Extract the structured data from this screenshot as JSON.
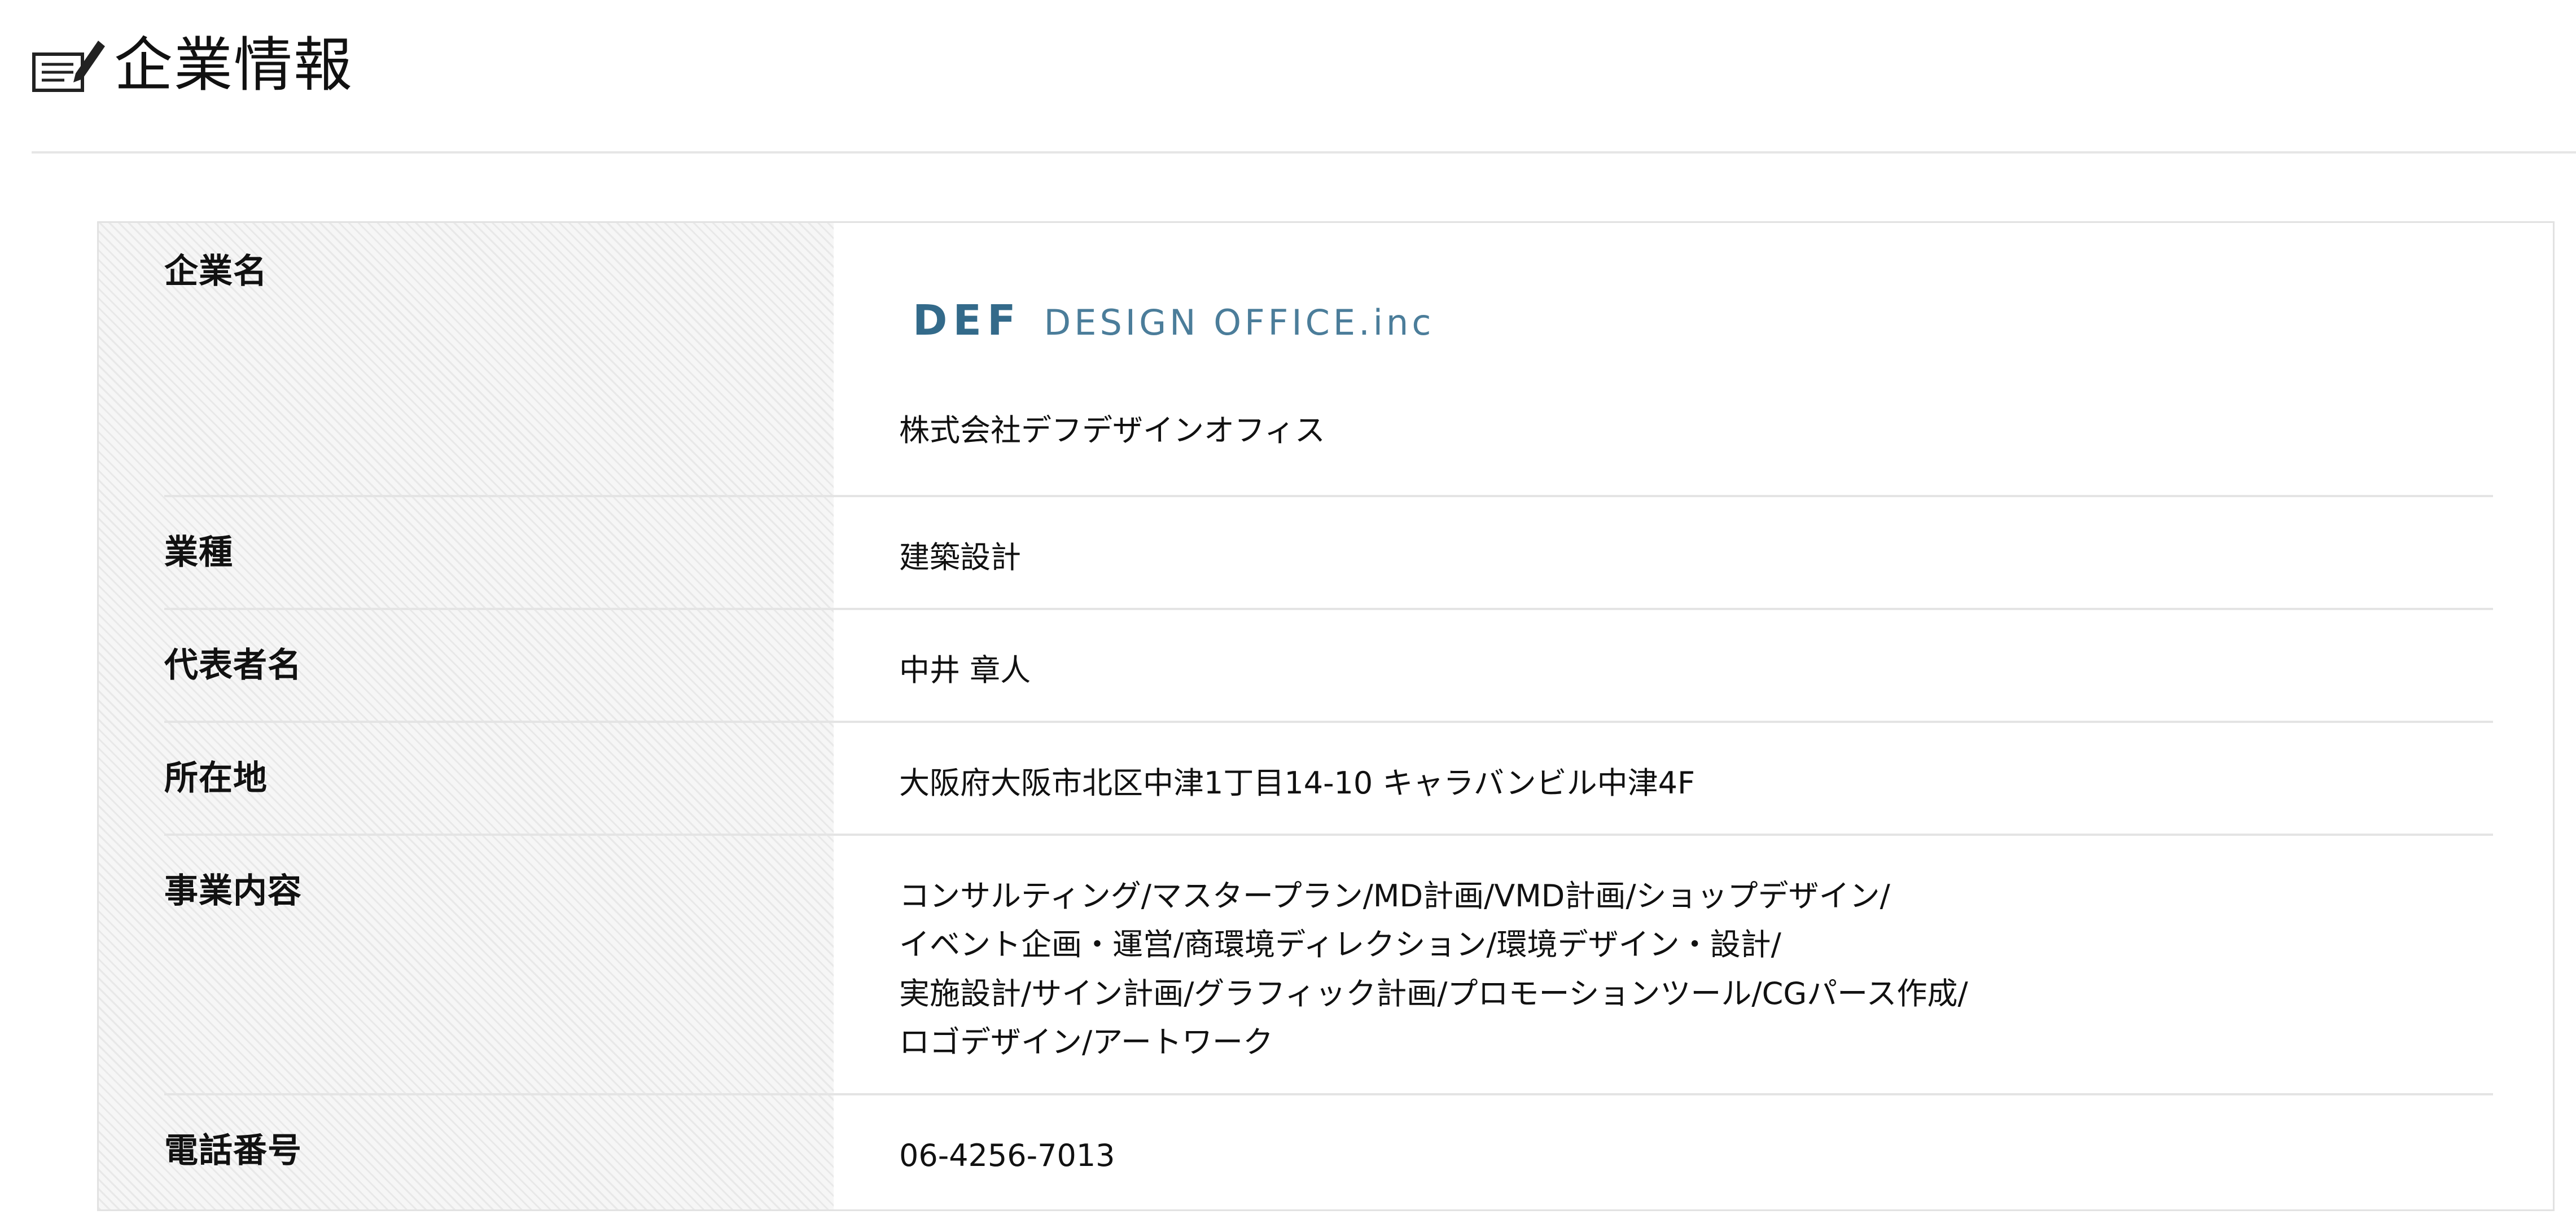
{
  "header": {
    "title": "企業情報",
    "icon": "note-pencil-icon"
  },
  "info": {
    "company": {
      "label": "企業名",
      "logo_mark": "DEF",
      "logo_text": "DESIGN OFFICE.inc",
      "name": "株式会社デフデザインオフィス"
    },
    "industry": {
      "label": "業種",
      "value": "建築設計"
    },
    "representative": {
      "label": "代表者名",
      "value": "中井 章人"
    },
    "address": {
      "label": "所在地",
      "value": "大阪府大阪市北区中津1丁目14-10 キャラバンビル中津4F"
    },
    "business": {
      "label": "事業内容",
      "lines": [
        "コンサルティング/マスタープラン/MD計画/VMD計画/ショップデザイン/",
        "イベント企画・運営/商環境ディレクション/環境デザイン・設計/",
        "実施設計/サイン計画/グラフィック計画/プロモーションツール/CGパース作成/",
        "ロゴデザイン/アートワーク"
      ]
    },
    "phone": {
      "label": "電話番号",
      "value": "06-4256-7013"
    }
  },
  "colors": {
    "logo_primary": "#336a8a",
    "logo_secondary": "#4b7d9a",
    "divider": "#e4e4e4"
  }
}
